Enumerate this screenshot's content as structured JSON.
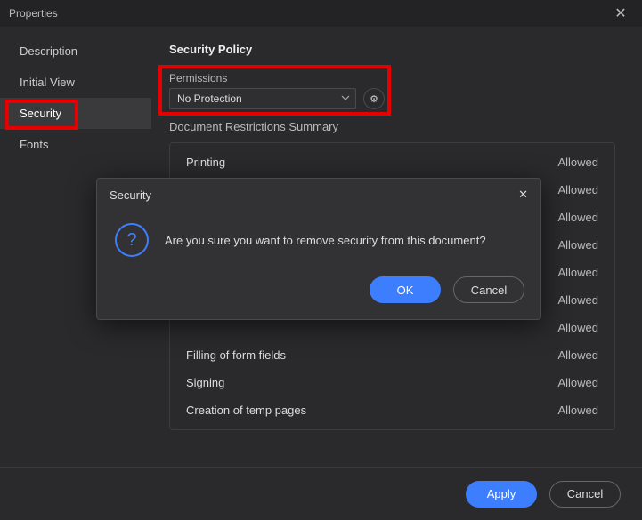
{
  "window": {
    "title": "Properties"
  },
  "sidebar": {
    "items": [
      {
        "label": "Description"
      },
      {
        "label": "Initial View"
      },
      {
        "label": "Security",
        "active": true
      },
      {
        "label": "Fonts"
      }
    ]
  },
  "content": {
    "section_title": "Security Policy",
    "permissions_label": "Permissions",
    "permissions_value": "No Protection",
    "restrictions_header": "Document Restrictions Summary",
    "restrictions": [
      {
        "label": "Printing",
        "value": "Allowed"
      },
      {
        "label": "",
        "value": "Allowed"
      },
      {
        "label": "",
        "value": "Allowed"
      },
      {
        "label": "",
        "value": "Allowed"
      },
      {
        "label": "",
        "value": "Allowed"
      },
      {
        "label": "",
        "value": "Allowed"
      },
      {
        "label": "",
        "value": "Allowed"
      },
      {
        "label": "Filling of form fields",
        "value": "Allowed"
      },
      {
        "label": "Signing",
        "value": "Allowed"
      },
      {
        "label": "Creation of temp pages",
        "value": "Allowed"
      }
    ]
  },
  "modal": {
    "title": "Security",
    "message": "Are you sure you want to remove security from this document?",
    "ok": "OK",
    "cancel": "Cancel"
  },
  "footer": {
    "apply": "Apply",
    "cancel": "Cancel"
  }
}
